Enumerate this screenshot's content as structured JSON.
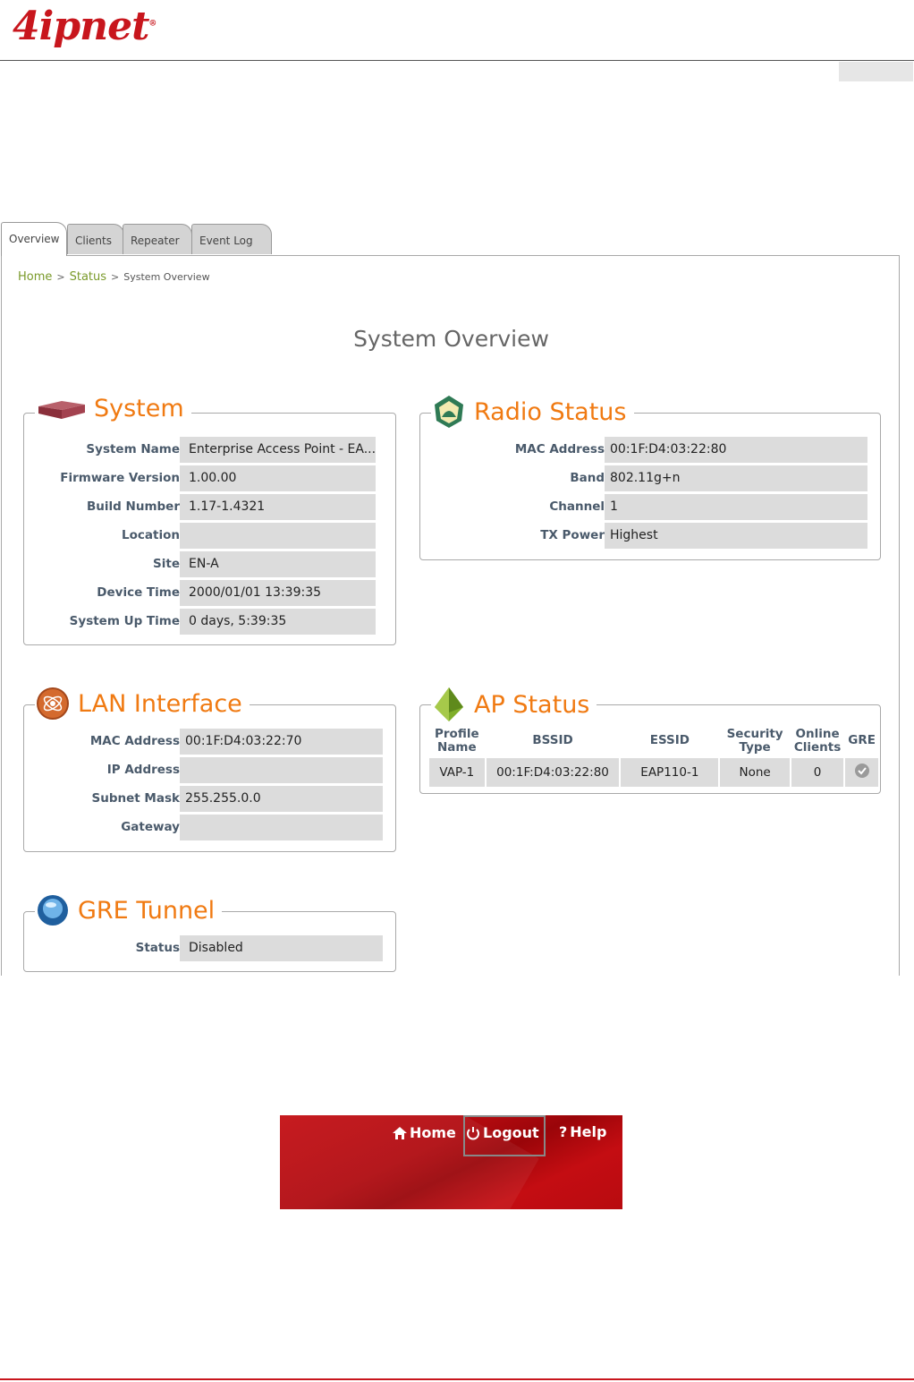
{
  "brand": {
    "logo_text": "4ipnet",
    "logo_mark": "®"
  },
  "tabs": [
    {
      "label": "Overview",
      "active": true
    },
    {
      "label": "Clients",
      "active": false
    },
    {
      "label": "Repeater",
      "active": false
    },
    {
      "label": "Event Log",
      "active": false
    }
  ],
  "breadcrumb": {
    "home": "Home",
    "sep1": ">",
    "status": "Status",
    "sep2": ">",
    "current": "System Overview"
  },
  "page_title": "System Overview",
  "system": {
    "title": "System",
    "rows": [
      {
        "label": "System Name",
        "value": "Enterprise Access Point - EA..."
      },
      {
        "label": "Firmware Version",
        "value": "1.00.00"
      },
      {
        "label": "Build Number",
        "value": "1.17-1.4321"
      },
      {
        "label": "Location",
        "value": ""
      },
      {
        "label": "Site",
        "value": "EN-A"
      },
      {
        "label": "Device Time",
        "value": "2000/01/01 13:39:35"
      },
      {
        "label": "System Up Time",
        "value": "0 days, 5:39:35"
      }
    ]
  },
  "radio": {
    "title": "Radio Status",
    "rows": [
      {
        "label": "MAC Address",
        "value": "00:1F:D4:03:22:80"
      },
      {
        "label": "Band",
        "value": "802.11g+n"
      },
      {
        "label": "Channel",
        "value": "1"
      },
      {
        "label": "TX Power",
        "value": "Highest"
      }
    ]
  },
  "lan": {
    "title": "LAN Interface",
    "rows": [
      {
        "label": "MAC Address",
        "value": "00:1F:D4:03:22:70"
      },
      {
        "label": "IP Address",
        "value": ""
      },
      {
        "label": "Subnet Mask",
        "value": "255.255.0.0"
      },
      {
        "label": "Gateway",
        "value": ""
      }
    ]
  },
  "ap_status": {
    "title": "AP Status",
    "headers": {
      "profile_1": "Profile",
      "profile_2": "Name",
      "bssid": "BSSID",
      "essid": "ESSID",
      "security_1": "Security",
      "security_2": "Type",
      "online_1": "Online",
      "online_2": "Clients",
      "gre": "GRE"
    },
    "row": {
      "profile": "VAP-1",
      "bssid": "00:1F:D4:03:22:80",
      "essid": "EAP110-1",
      "security": "None",
      "clients": "0"
    }
  },
  "gre": {
    "title": "GRE Tunnel",
    "rows": [
      {
        "label": "Status",
        "value": "Disabled"
      }
    ]
  },
  "top_nav": {
    "home": "Home",
    "logout": "Logout",
    "help": "Help",
    "help_glyph": "?",
    "accent": "#c40d12"
  },
  "colors": {
    "section_title": "#f07a12",
    "breadcrumb_link": "#7a9a2a",
    "brand": "#c8161d"
  }
}
